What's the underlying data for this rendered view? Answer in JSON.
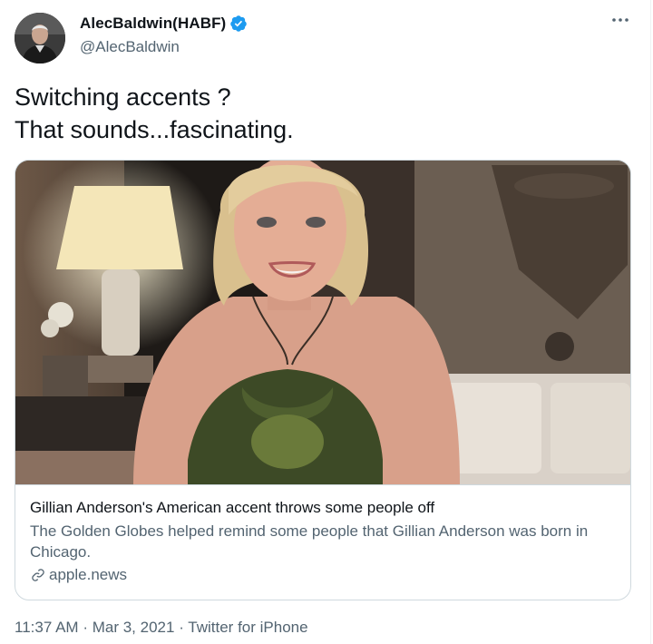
{
  "author": {
    "display_name": "AlecBaldwin(HABF)",
    "handle": "@AlecBaldwin",
    "verified": true
  },
  "tweet": {
    "text_lines": [
      "Switching accents ?",
      "That sounds...fascinating."
    ]
  },
  "card": {
    "title": "Gillian Anderson's American accent throws some people off",
    "description": "The Golden Globes helped remind some people that Gillian Anderson was born in Chicago.",
    "domain": "apple.news"
  },
  "meta": {
    "time": "11:37 AM",
    "separator": "·",
    "date": "Mar 3, 2021",
    "source": "Twitter for iPhone"
  },
  "colors": {
    "verified": "#1d9bf0",
    "secondary_text": "#536471",
    "border": "#cfd9de"
  },
  "icons": [
    "verified-badge-icon",
    "more-options-icon",
    "link-icon"
  ]
}
